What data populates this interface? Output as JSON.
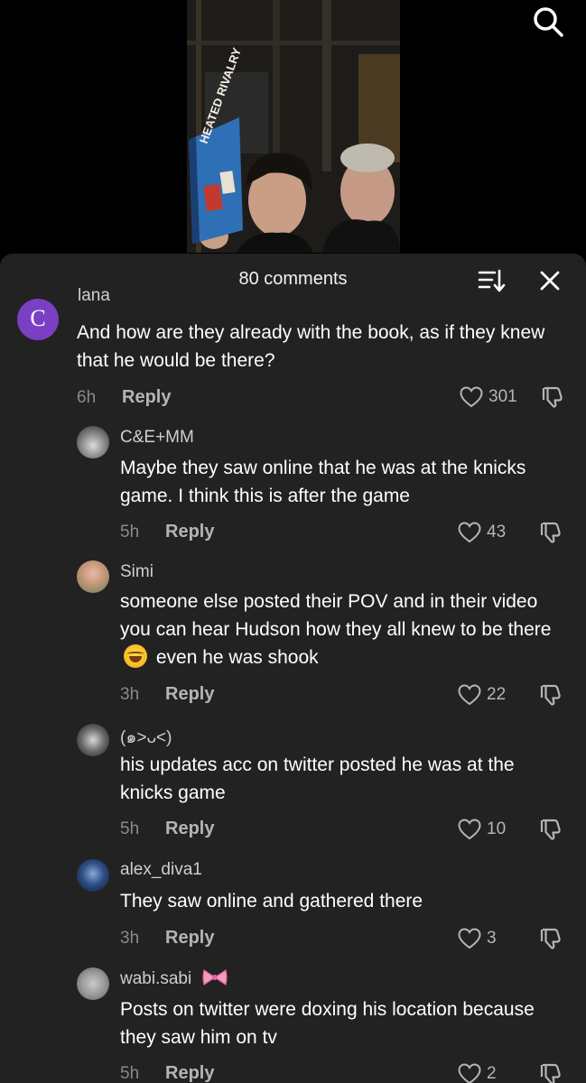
{
  "header": {
    "comment_count": "80 comments"
  },
  "icons": {
    "search": "search-icon",
    "sort": "sort-icon",
    "close": "close-icon",
    "like": "heart-icon",
    "dislike": "dislike-icon"
  },
  "colors": {
    "sheet_bg": "#222222",
    "avatar_c": "#7b3fc4"
  },
  "video": {
    "book_title": "HEATED RIVALRY"
  },
  "comments": [
    {
      "username": "lana",
      "avatar_letter": "C",
      "text": "And how are they already with the book, as if they knew that he would be there?",
      "time": "6h",
      "reply_label": "Reply",
      "likes": "301"
    },
    {
      "username": "C&E+MM",
      "text": "Maybe they saw online that he was at the knicks game. I think this is after the game",
      "time": "5h",
      "reply_label": "Reply",
      "likes": "43"
    },
    {
      "username": "Simi",
      "text_before": "someone else posted their POV and in their video you can hear Hudson how they all knew to be there",
      "text_after": "even he was shook",
      "emoji": "face-with-tears-of-joy",
      "time": "3h",
      "reply_label": "Reply",
      "likes": "22"
    },
    {
      "username": "(๑˃ᴗ˂)",
      "text": "his updates acc on twitter posted he was at the knicks game",
      "time": "5h",
      "reply_label": "Reply",
      "likes": "10"
    },
    {
      "username": "alex_diva1",
      "text": "They saw online and gathered there",
      "time": "3h",
      "reply_label": "Reply",
      "likes": "3"
    },
    {
      "username": "wabi.sabi",
      "username_emoji": "ribbon",
      "text": "Posts on twitter were doxing his location because they saw him on tv",
      "time": "5h",
      "reply_label": "Reply",
      "likes": "2"
    }
  ]
}
